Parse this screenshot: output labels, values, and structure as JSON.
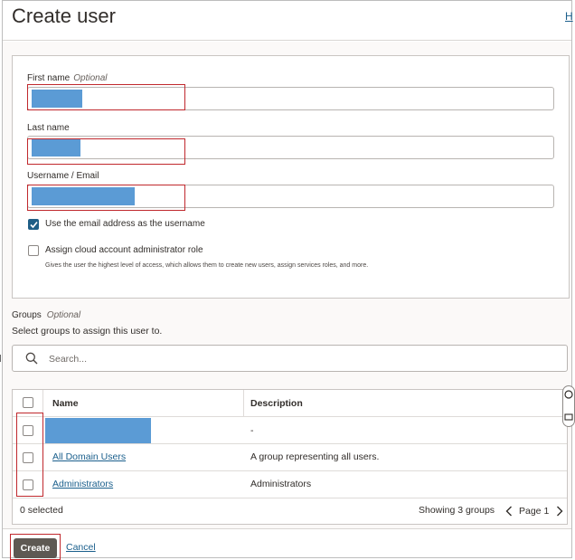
{
  "header": {
    "title": "Create user",
    "help_link": "H"
  },
  "form": {
    "first_name": {
      "label": "First name",
      "optional": "Optional",
      "value": ""
    },
    "last_name": {
      "label": "Last name",
      "value": ""
    },
    "username": {
      "label": "Username / Email",
      "value": ""
    },
    "use_email_checkbox": {
      "label": "Use the email address as the username",
      "checked": true
    },
    "admin_role_checkbox": {
      "label": "Assign cloud account administrator role",
      "help": "Gives the user the highest level of access, which allows them to create new users, assign services roles, and more.",
      "checked": false
    }
  },
  "groups": {
    "title": "Groups",
    "optional": "Optional",
    "help": "Select groups to assign this user to.",
    "search_placeholder": "Search...",
    "columns": [
      "Name",
      "Description"
    ],
    "rows": [
      {
        "name": "",
        "description": "-"
      },
      {
        "name": "All Domain Users",
        "description": "A group representing all users."
      },
      {
        "name": "Administrators",
        "description": "Administrators"
      }
    ],
    "selected_text": "0 selected",
    "showing_text": "Showing 3 groups",
    "page_text": "Page 1"
  },
  "footer": {
    "create_label": "Create",
    "cancel_label": "Cancel"
  },
  "colors": {
    "accent": "#1f5e86",
    "annotation": "#c0282d",
    "redaction": "#5b9bd5"
  }
}
